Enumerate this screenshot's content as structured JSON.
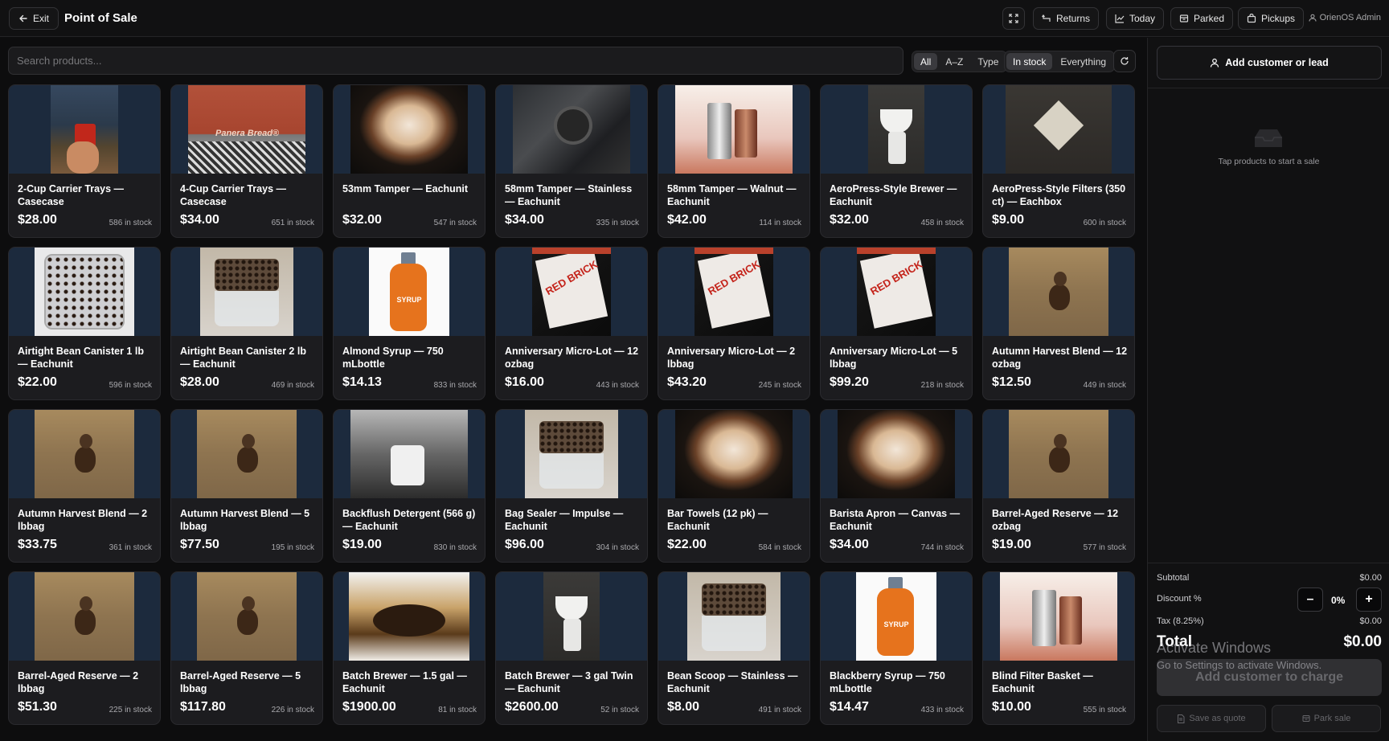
{
  "topbar": {
    "exit_label": "Exit",
    "title": "Point of Sale",
    "returns_label": "Returns",
    "today_label": "Today",
    "parked_label": "Parked",
    "pickups_label": "Pickups",
    "user_label": "OrienOS Admin"
  },
  "search": {
    "placeholder": "Search products..."
  },
  "sort_filters": [
    "All",
    "A–Z",
    "Type"
  ],
  "sort_active": "All",
  "stock_filters": [
    "In stock",
    "Everything"
  ],
  "stock_active": "In stock",
  "products": [
    {
      "name": "2-Cup Carrier Trays — Casecase",
      "price": "$28.00",
      "stock": "586 in stock",
      "image": "carrier-cup-photo"
    },
    {
      "name": "4-Cup Carrier Trays — Casecase",
      "price": "$34.00",
      "stock": "651 in stock",
      "image": "panera-cup-photo",
      "image_text": "Panera Bread®"
    },
    {
      "name": "53mm Tamper — Eachunit",
      "price": "$32.00",
      "stock": "547 in stock",
      "image": "latte-cup-photo"
    },
    {
      "name": "58mm Tamper — Stainless — Eachunit",
      "price": "$34.00",
      "stock": "335 in stock",
      "image": "barista-tamping-photo"
    },
    {
      "name": "58mm Tamper — Walnut — Eachunit",
      "price": "$42.00",
      "stock": "114 in stock",
      "image": "pitchers-photo"
    },
    {
      "name": "AeroPress-Style Brewer — Eachunit",
      "price": "$32.00",
      "stock": "458 in stock",
      "image": "pourover-dripper-photo"
    },
    {
      "name": "AeroPress-Style Filters (350 ct) — Eachbox",
      "price": "$9.00",
      "stock": "600 in stock",
      "image": "paper-crane-photo"
    },
    {
      "name": "Airtight Bean Canister 1 lb — Eachunit",
      "price": "$22.00",
      "stock": "596 in stock",
      "image": "bean-box-top-photo"
    },
    {
      "name": "Airtight Bean Canister 2 lb — Eachunit",
      "price": "$28.00",
      "stock": "469 in stock",
      "image": "bean-box-side-photo"
    },
    {
      "name": "Almond Syrup — 750 mLbottle",
      "price": "$14.13",
      "stock": "833 in stock",
      "image": "syrup-bottle-photo",
      "image_text": "SYRUP"
    },
    {
      "name": "Anniversary Micro-Lot — 12 ozbag",
      "price": "$16.00",
      "stock": "443 in stock",
      "image": "red-brick-bag-photo",
      "image_text": "RED BRICK"
    },
    {
      "name": "Anniversary Micro-Lot — 2 lbbag",
      "price": "$43.20",
      "stock": "245 in stock",
      "image": "red-brick-bag-photo",
      "image_text": "RED BRICK"
    },
    {
      "name": "Anniversary Micro-Lot — 5 lbbag",
      "price": "$99.20",
      "stock": "218 in stock",
      "image": "red-brick-bag-photo",
      "image_text": "RED BRICK"
    },
    {
      "name": "Autumn Harvest Blend — 12 ozbag",
      "price": "$12.50",
      "stock": "449 in stock",
      "image": "bean-figure-photo"
    },
    {
      "name": "Autumn Harvest Blend — 2 lbbag",
      "price": "$33.75",
      "stock": "361 in stock",
      "image": "bean-figure-photo"
    },
    {
      "name": "Autumn Harvest Blend — 5 lbbag",
      "price": "$77.50",
      "stock": "195 in stock",
      "image": "bean-figure-photo"
    },
    {
      "name": "Backflush Detergent (566 g) — Eachunit",
      "price": "$19.00",
      "stock": "830 in stock",
      "image": "crowd-bw-photo"
    },
    {
      "name": "Bag Sealer — Impulse — Eachunit",
      "price": "$96.00",
      "stock": "304 in stock",
      "image": "bean-box-side-photo"
    },
    {
      "name": "Bar Towels (12 pk) — Eachunit",
      "price": "$22.00",
      "stock": "584 in stock",
      "image": "latte-cup-photo"
    },
    {
      "name": "Barista Apron — Canvas — Eachunit",
      "price": "$34.00",
      "stock": "744 in stock",
      "image": "latte-cup-photo"
    },
    {
      "name": "Barrel-Aged Reserve — 12 ozbag",
      "price": "$19.00",
      "stock": "577 in stock",
      "image": "bean-figure-photo"
    },
    {
      "name": "Barrel-Aged Reserve — 2 lbbag",
      "price": "$51.30",
      "stock": "225 in stock",
      "image": "bean-figure-photo"
    },
    {
      "name": "Barrel-Aged Reserve — 5 lbbag",
      "price": "$117.80",
      "stock": "226 in stock",
      "image": "bean-figure-photo"
    },
    {
      "name": "Batch Brewer — 1.5 gal — Eachunit",
      "price": "$1900.00",
      "stock": "81 in stock",
      "image": "pourover-brewing-photo"
    },
    {
      "name": "Batch Brewer — 3 gal Twin — Eachunit",
      "price": "$2600.00",
      "stock": "52 in stock",
      "image": "pourover-dripper-photo"
    },
    {
      "name": "Bean Scoop — Stainless — Eachunit",
      "price": "$8.00",
      "stock": "491 in stock",
      "image": "bean-box-side-photo"
    },
    {
      "name": "Blackberry Syrup — 750 mLbottle",
      "price": "$14.47",
      "stock": "433 in stock",
      "image": "syrup-bottle-photo",
      "image_text": "SYRUP"
    },
    {
      "name": "Blind Filter Basket — Eachunit",
      "price": "$10.00",
      "stock": "555 in stock",
      "image": "pitchers-photo"
    }
  ],
  "cart": {
    "add_customer_label": "Add customer or lead",
    "empty_text": "Tap products to start a sale",
    "subtotal_label": "Subtotal",
    "subtotal_value": "$0.00",
    "discount_label": "Discount %",
    "discount_value": "0%",
    "discount_minus": "–",
    "discount_plus": "+",
    "tax_label": "Tax (8.25%)",
    "tax_value": "$0.00",
    "total_label": "Total",
    "total_value": "$0.00",
    "charge_label": "Add customer to charge",
    "save_quote_label": "Save as quote",
    "park_label": "Park sale"
  },
  "watermark": {
    "line1": "Activate Windows",
    "line2": "Go to Settings to activate Windows."
  },
  "colors": {
    "background": "#0d0d0e",
    "panel": "#111112",
    "card": "#1c1c1f",
    "thumb_bg": "#1c2a3d"
  }
}
